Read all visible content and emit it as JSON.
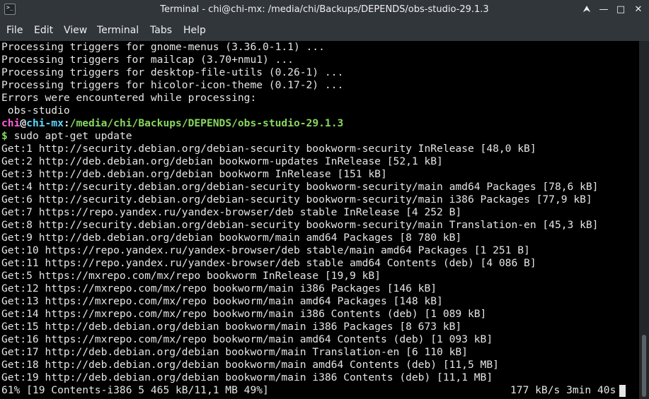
{
  "window": {
    "title": "Terminal - chi@chi-mx: /media/chi/Backups/DEPENDS/obs-studio-29.1.3",
    "app_icon_glyph": ">_",
    "controls": {
      "up": "⮝",
      "minimize": "—",
      "maximize": "□",
      "close": "✕"
    }
  },
  "menu": {
    "items": [
      {
        "label": "File"
      },
      {
        "label": "Edit"
      },
      {
        "label": "View"
      },
      {
        "label": "Terminal"
      },
      {
        "label": "Tabs"
      },
      {
        "label": "Help"
      }
    ]
  },
  "terminal": {
    "pre_lines": [
      "Processing triggers for gnome-menus (3.36.0-1.1) ...",
      "Processing triggers for mailcap (3.70+nmu1) ...",
      "Processing triggers for desktop-file-utils (0.26-1) ...",
      "Processing triggers for hicolor-icon-theme (0.17-2) ...",
      "Errors were encountered while processing:",
      " obs-studio"
    ],
    "prompt": {
      "user": "chi",
      "at": "@",
      "host": "chi-mx",
      "colon": ":",
      "path": "/media/chi/Backups/DEPENDS/obs-studio-29.1.3",
      "dollar": "$",
      "command": " sudo apt-get update"
    },
    "output_lines": [
      "Get:1 http://security.debian.org/debian-security bookworm-security InRelease [48,0 kB]",
      "Get:2 http://deb.debian.org/debian bookworm-updates InRelease [52,1 kB]",
      "Get:3 http://deb.debian.org/debian bookworm InRelease [151 kB]",
      "Get:4 http://security.debian.org/debian-security bookworm-security/main amd64 Packages [78,6 kB]",
      "Get:6 http://security.debian.org/debian-security bookworm-security/main i386 Packages [77,9 kB]",
      "Get:7 https://repo.yandex.ru/yandex-browser/deb stable InRelease [4 252 B]",
      "Get:8 http://security.debian.org/debian-security bookworm-security/main Translation-en [45,3 kB]",
      "Get:9 http://deb.debian.org/debian bookworm/main amd64 Packages [8 780 kB]",
      "Get:10 https://repo.yandex.ru/yandex-browser/deb stable/main amd64 Packages [1 251 B]",
      "Get:11 https://repo.yandex.ru/yandex-browser/deb stable amd64 Contents (deb) [4 086 B]",
      "Get:5 https://mxrepo.com/mx/repo bookworm InRelease [19,9 kB]",
      "Get:12 https://mxrepo.com/mx/repo bookworm/main i386 Packages [146 kB]",
      "Get:13 https://mxrepo.com/mx/repo bookworm/main amd64 Packages [148 kB]",
      "Get:14 https://mxrepo.com/mx/repo bookworm/main i386 Contents (deb) [1 089 kB]",
      "Get:15 http://deb.debian.org/debian bookworm/main i386 Packages [8 673 kB]",
      "Get:16 https://mxrepo.com/mx/repo bookworm/main amd64 Contents (deb) [1 093 kB]",
      "Get:17 http://deb.debian.org/debian bookworm/main Translation-en [6 110 kB]",
      "Get:18 http://deb.debian.org/debian bookworm/main amd64 Contents (deb) [11,5 MB]",
      "Get:19 http://deb.debian.org/debian bookworm/main i386 Contents (deb) [11,1 MB]"
    ],
    "status_left": "61% [19 Contents-i386 5 465 kB/11,1 MB 49%]",
    "status_right": "177 kB/s 3min 40s"
  },
  "colors": {
    "chrome_bg": "#31363b",
    "chrome_text": "#eff0f1",
    "terminal_bg": "#000000",
    "terminal_text": "#e5e5e5",
    "prompt_user": "#ff5fd7",
    "prompt_host": "#5fd7ff",
    "prompt_path": "#87d75f"
  }
}
